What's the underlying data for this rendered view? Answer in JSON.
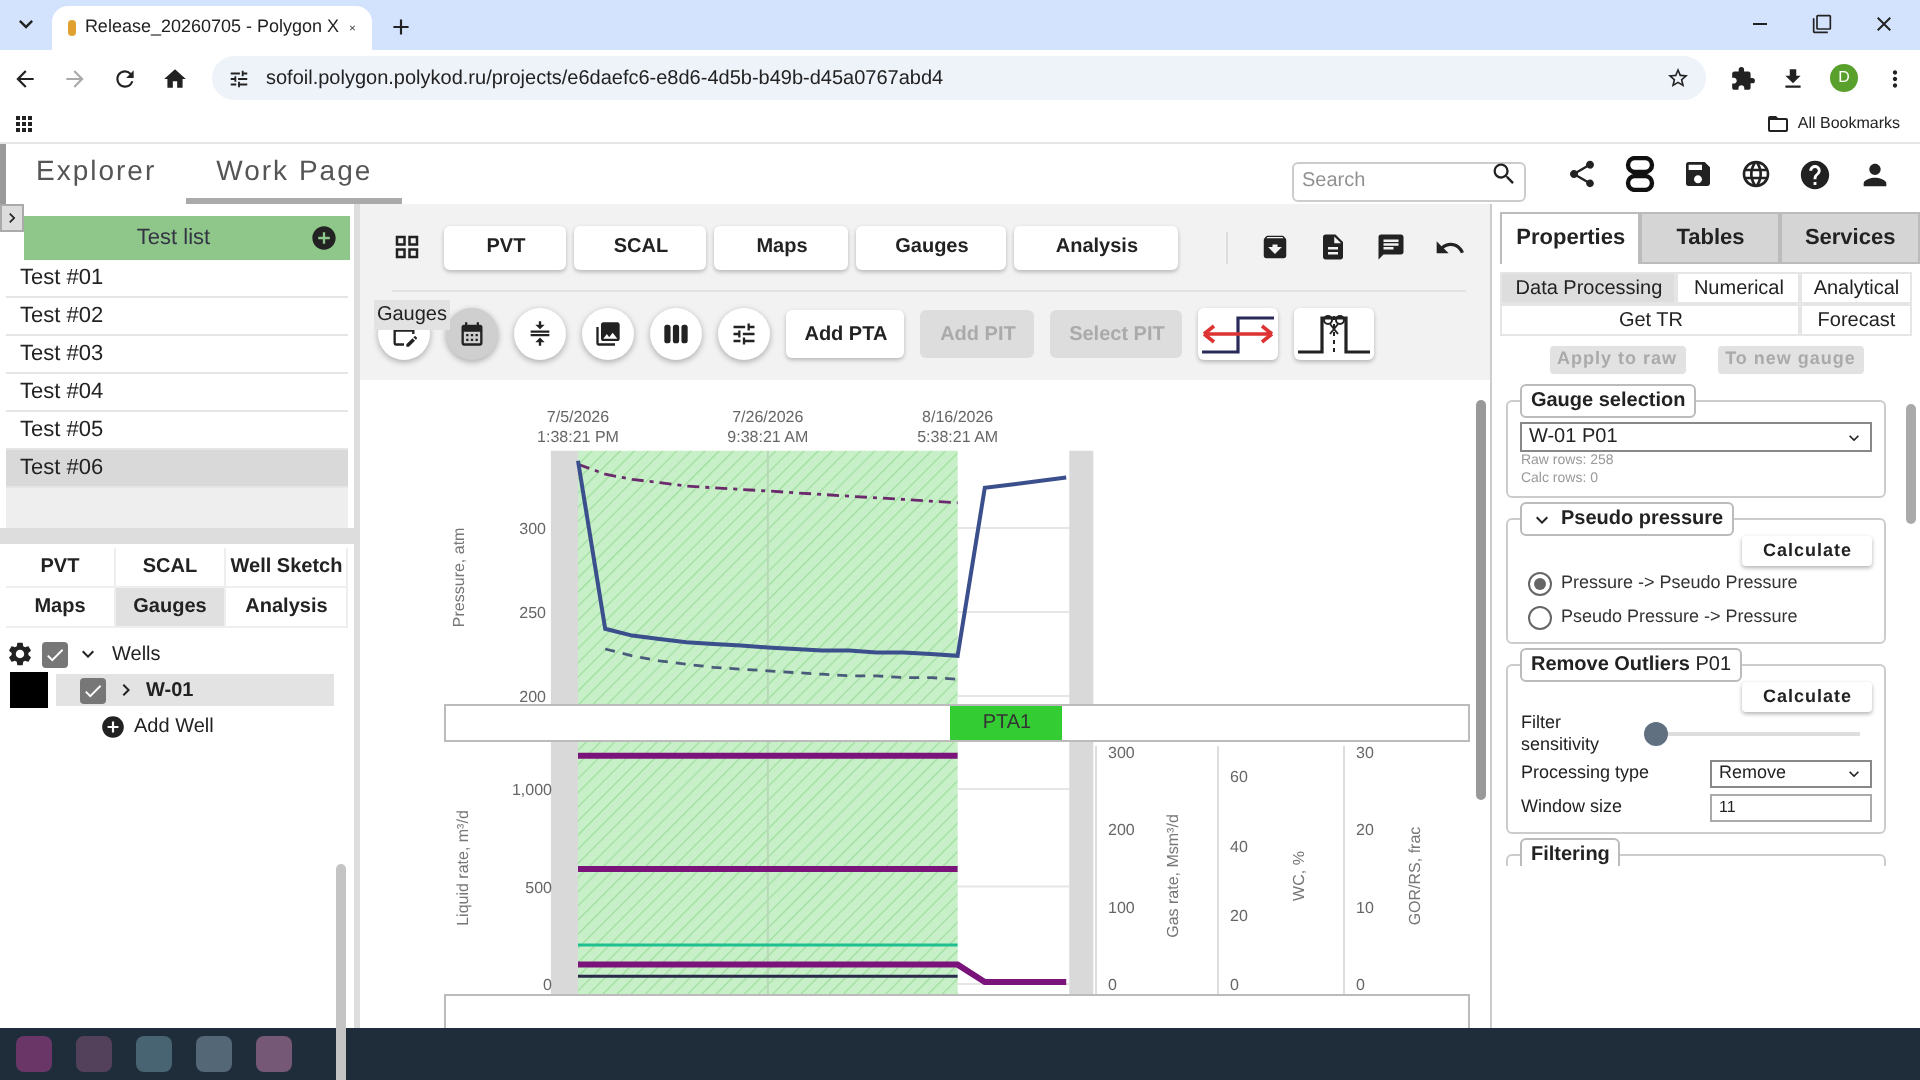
{
  "browser": {
    "tab_title": "Release_20260705 - Polygon X",
    "url": "sofoil.polygon.polykod.ru/projects/e6daefc6-e8d6-4d5b-b49b-d45a0767abd4",
    "profile_initial": "D",
    "bookmarks_label": "All Bookmarks"
  },
  "app_tabs": [
    {
      "label": "Explorer",
      "selected": false
    },
    {
      "label": "Work Page",
      "selected": true
    }
  ],
  "search": {
    "placeholder": "Search"
  },
  "test_list": {
    "title": "Test list",
    "items": [
      {
        "label": "Test #01",
        "selected": false
      },
      {
        "label": "Test #02",
        "selected": false
      },
      {
        "label": "Test #03",
        "selected": false
      },
      {
        "label": "Test #04",
        "selected": false
      },
      {
        "label": "Test #05",
        "selected": false
      },
      {
        "label": "Test #06",
        "selected": true
      }
    ]
  },
  "module_tabs": [
    {
      "label": "PVT",
      "selected": false
    },
    {
      "label": "SCAL",
      "selected": false
    },
    {
      "label": "Well Sketch",
      "selected": false
    },
    {
      "label": "Maps",
      "selected": false
    },
    {
      "label": "Gauges",
      "selected": true
    },
    {
      "label": "Analysis",
      "selected": false
    }
  ],
  "tree": {
    "label": "Wells",
    "checked": true,
    "expanded": true,
    "children": [
      {
        "label": "W-01",
        "checked": true,
        "expanded": false,
        "selected": true,
        "color": "#000000"
      }
    ],
    "add_label": "Add Well"
  },
  "toolbar": {
    "nav_buttons": [
      "PVT",
      "SCAL",
      "Maps",
      "Gauges",
      "Analysis"
    ],
    "tooltip": "Gauges",
    "tool_buttons": [
      {
        "selected": false
      },
      {
        "selected": true
      },
      {
        "selected": false
      },
      {
        "selected": false
      },
      {
        "selected": false
      },
      {
        "selected": false
      }
    ],
    "actions": [
      {
        "label": "Add PTA",
        "disabled": false
      },
      {
        "label": "Add PIT",
        "disabled": true
      },
      {
        "label": "Select PIT",
        "disabled": true
      }
    ]
  },
  "pressure_chart": {
    "chart_data": {
      "type": "line",
      "ylabel": "Pressure, atm",
      "categories": [
        "7/5/2026",
        null,
        null,
        null,
        null,
        null,
        null,
        "7/26/2026",
        null,
        null,
        null,
        null,
        null,
        null,
        "8/16/2026",
        null,
        null,
        null,
        null
      ],
      "series": [
        {
          "color": "#6b2a6b",
          "line_style": "dashdot",
          "values": [
            338,
            332,
            329,
            327,
            325,
            324,
            323,
            322,
            321,
            320,
            319,
            318,
            317,
            316,
            315,
            null,
            null,
            null,
            null
          ]
        },
        {
          "color": "#3b4f8c",
          "line_style": "solid",
          "values": [
            340,
            240,
            236,
            234,
            232,
            231,
            230,
            229,
            228,
            227,
            227,
            226,
            226,
            225,
            224,
            324,
            326,
            328,
            330
          ]
        },
        {
          "color": "#4a5a7a",
          "line_style": "dashed",
          "values": [
            null,
            228,
            224,
            221,
            219,
            217,
            216,
            215,
            214,
            213,
            212,
            212,
            211,
            211,
            210,
            null,
            null,
            null,
            null
          ]
        }
      ],
      "ylim": [
        198,
        346
      ],
      "yticks": [
        200,
        250,
        300
      ]
    },
    "xtick_times": [
      "1:38:21 PM",
      "9:38:21 AM",
      "5:38:21 AM"
    ]
  },
  "period_band": {
    "label": "PTA1"
  },
  "rates_chart": {
    "chart_data": {
      "type": "line",
      "ylabel": "Liquid rate, m³/d",
      "categories": [
        null,
        null,
        null,
        null,
        null,
        null,
        null,
        null,
        null,
        null,
        null,
        null,
        null,
        null,
        null,
        null,
        null,
        null,
        null
      ],
      "series": [
        {
          "color": "#7a137a",
          "values": [
            1170,
            1170,
            1170,
            1170,
            1170,
            1170,
            1170,
            1170,
            1170,
            1170,
            1170,
            1170,
            1170,
            1170,
            1170,
            null,
            null,
            null,
            null
          ]
        },
        {
          "color": "#7a137a",
          "values": [
            590,
            590,
            590,
            590,
            590,
            590,
            590,
            590,
            590,
            590,
            590,
            590,
            590,
            590,
            590,
            null,
            null,
            null,
            null
          ]
        },
        {
          "color": "#7a137a",
          "values": [
            100,
            100,
            100,
            100,
            100,
            100,
            100,
            100,
            100,
            100,
            100,
            100,
            100,
            100,
            100,
            10,
            10,
            10,
            10
          ]
        },
        {
          "color": "#1fbf8f",
          "values": [
            200,
            200,
            200,
            200,
            200,
            200,
            200,
            200,
            200,
            200,
            200,
            200,
            200,
            200,
            200,
            null,
            null,
            null,
            null
          ]
        },
        {
          "color": "#2a2a4a",
          "values": [
            40,
            40,
            40,
            40,
            40,
            40,
            40,
            40,
            40,
            40,
            40,
            40,
            40,
            40,
            40,
            null,
            null,
            null,
            null
          ]
        }
      ],
      "ylim": [
        0,
        1200
      ],
      "yticks": [
        0,
        500,
        {
          "value": 1000,
          "label": "1,000"
        }
      ]
    },
    "extra_axes": [
      {
        "label": "Gas rate, Msm³/d",
        "ticks": [
          "300",
          "200",
          "100",
          "0"
        ]
      },
      {
        "label": "WC, %",
        "ticks": [
          "60",
          "40",
          "20",
          "0"
        ]
      },
      {
        "label": "GOR/RS, frac",
        "ticks": [
          "30",
          "20",
          "10",
          "0"
        ]
      }
    ]
  },
  "right_tabs": [
    {
      "label": "Properties",
      "selected": true
    },
    {
      "label": "Tables",
      "selected": false
    },
    {
      "label": "Services",
      "selected": false
    }
  ],
  "sub_tabs": [
    {
      "label": "Data Processing",
      "selected": true
    },
    {
      "label": "Numerical",
      "selected": false
    },
    {
      "label": "Analytical",
      "selected": false
    },
    {
      "label": "Get TR",
      "selected": false
    },
    {
      "label": "Forecast",
      "selected": false
    }
  ],
  "panel_buttons": [
    {
      "label": "Apply to raw",
      "disabled": true
    },
    {
      "label": "To new gauge",
      "disabled": true
    }
  ],
  "gauge_selection": {
    "title": "Gauge selection",
    "value": "W-01 P01",
    "info": [
      "Raw rows: 258",
      "Calc rows: 0"
    ]
  },
  "pseudo_pressure": {
    "title": "Pseudo pressure",
    "expanded": true,
    "button": "Calculate",
    "options": [
      {
        "label": "Pressure -> Pseudo Pressure",
        "selected": true
      },
      {
        "label": "Pseudo Pressure -> Pressure",
        "selected": false
      }
    ]
  },
  "remove_outliers": {
    "title": "**Remove Outliers** P01",
    "button": "Calculate",
    "sensitivity": {
      "label": "Filter sensitivity",
      "level": 0
    },
    "processing_type": {
      "label": "Processing type",
      "value": "Remove"
    },
    "window_size": {
      "label": "Window size",
      "value": "11"
    }
  },
  "filtering": {
    "title": "Filtering"
  }
}
